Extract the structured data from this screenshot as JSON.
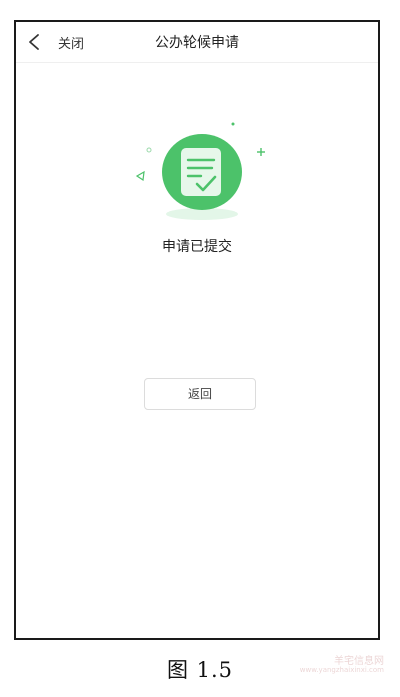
{
  "navbar": {
    "close_label": "关闭",
    "title": "公办轮候申请"
  },
  "content": {
    "status_text": "申请已提交",
    "return_button_label": "返回"
  },
  "caption": "图 1.5",
  "watermark": {
    "text": "羊宅信息网",
    "url": "www.yangzhaixinxi.com"
  },
  "colors": {
    "accent_green": "#4cc26a",
    "light_green": "#e3f6e8"
  },
  "icons": [
    "chevron-left-icon",
    "document-check-icon"
  ]
}
